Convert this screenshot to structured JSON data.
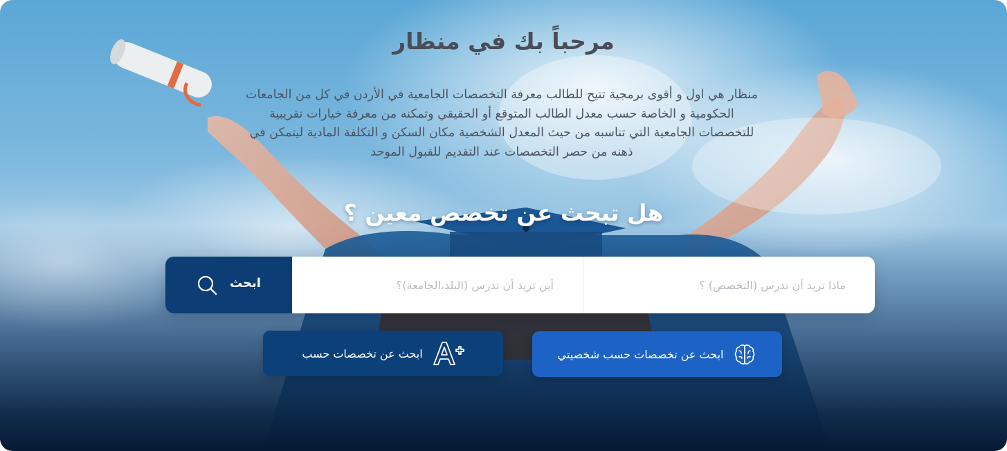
{
  "header": {
    "title": "مرحباً بك في منظار"
  },
  "intro": {
    "line1": "منظار هي اول و أقوى برمجية تتيح للطالب معرفة التخصصات الجامعية في الأردن في كل من الجامعات",
    "line2": "الحكومية و الخاصة حسب معدل الطالب المتوقع أو الحقيقي وتمكنه من معرفة خيارات تقريبية",
    "line3": "للتخصصات الجامعية التي تناسبه من حيث المعدل الشخصية مكان السكن و التكلفة المادية ليتمكن في",
    "line4": "ذهنه من حصر التخصصات عند التقديم للقبول الموحد"
  },
  "search": {
    "question": "هل تبحث عن تخصص معين ؟",
    "major_placeholder": "ماذا تريد أن تدرس (التخصص) ؟",
    "location_placeholder": "أين تريد أن تدرس (البلد،الجامعة)؟",
    "button_label": "ابحث",
    "button_icon": "search-icon"
  },
  "actions": {
    "personality_label": "ابحث عن تخصصات حسب شخصيتي",
    "personality_icon": "brain-icon",
    "grade_label": "ابحث عن تخصصات حسب",
    "grade_icon": "grade-a-plus-icon"
  },
  "colors": {
    "primary_dark": "#0c3d75",
    "primary_blue": "#1d63c6",
    "title_text": "#4a4d57"
  }
}
